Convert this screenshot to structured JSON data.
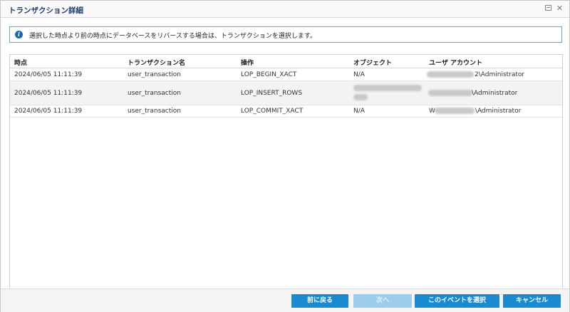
{
  "window": {
    "title": "トランザクション詳細",
    "restore_label": "",
    "close_label": "✕"
  },
  "info": {
    "message": "選択した時点より前の時点にデータベースをリバースする場合は、トランザクションを選択します。"
  },
  "table": {
    "columns": [
      "時点",
      "トランザクション名",
      "操作",
      "オブジェクト",
      "ユーザ アカウント"
    ],
    "rows": [
      {
        "time": "2024/06/05 11:11:39",
        "name": "user_transaction",
        "op": "LOP_BEGIN_XACT",
        "object": "N/A",
        "account_prefix": "2",
        "account": "\\Administrator"
      },
      {
        "time": "2024/06/05 11:11:39",
        "name": "user_transaction",
        "op": "LOP_INSERT_ROWS",
        "object": "",
        "account_prefix": "",
        "account": "\\Administrator"
      },
      {
        "time": "2024/06/05 11:11:39",
        "name": "user_transaction",
        "op": "LOP_COMMIT_XACT",
        "object": "N/A",
        "account_prefix": "W",
        "account": "\\Administrator"
      }
    ]
  },
  "footer": {
    "back": "前に戻る",
    "next": "次へ",
    "select_event": "このイベントを選択",
    "cancel": "キャンセル"
  },
  "colors": {
    "accent": "#1b8bd1",
    "title": "#1f3a6b",
    "info_border": "#6aa3cf"
  }
}
